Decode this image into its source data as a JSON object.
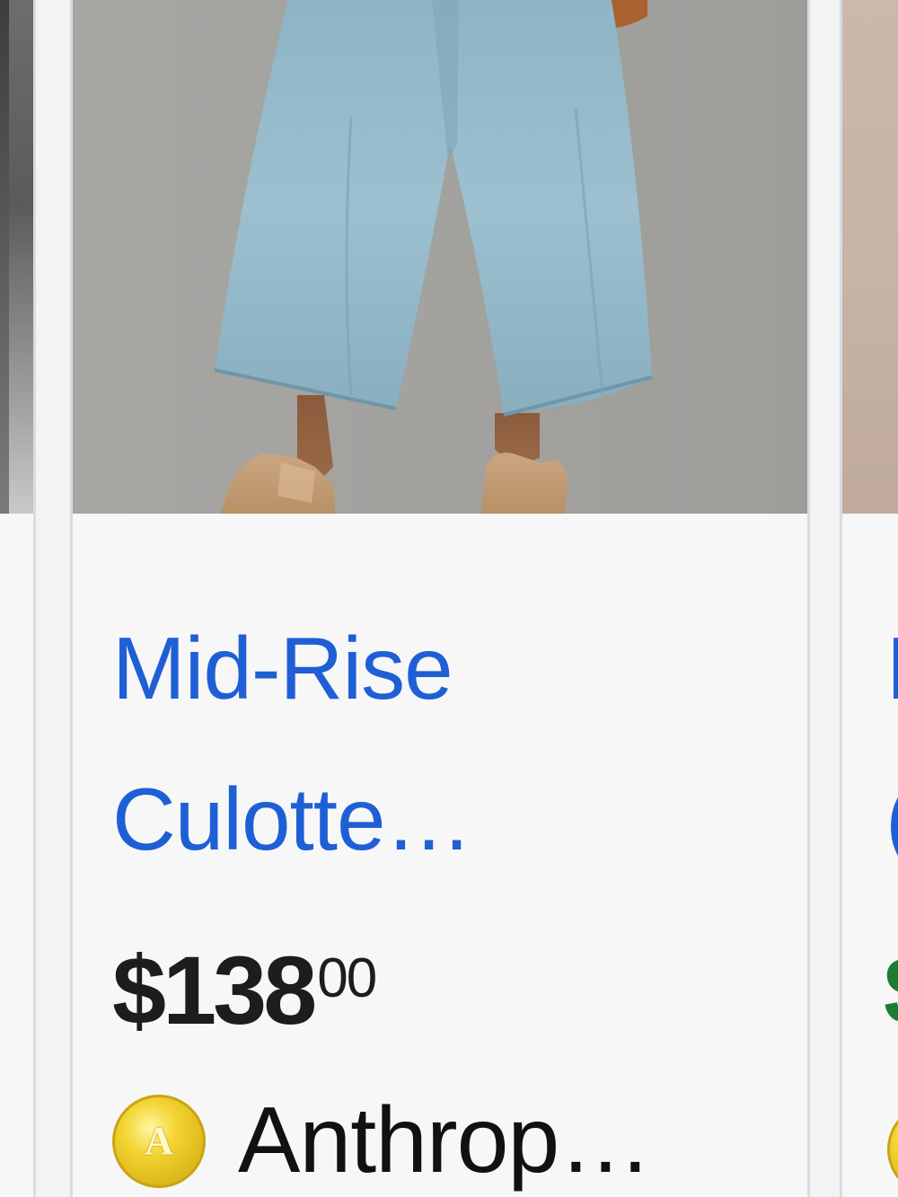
{
  "product": {
    "title_line1": "Mid-Rise",
    "title_line2": "Culotte…",
    "price_dollars": "$138",
    "price_cents": "00",
    "seller_name": "Anthrop…",
    "seller_logo_letter": "A"
  },
  "colors": {
    "title_link": "#1f5fd6",
    "price": "#1d1d1d",
    "next_price": "#1e7b34",
    "card_background": "#f7f7f7",
    "card_border": "#d9dbde",
    "seller_logo": "#f2d431"
  },
  "next_card": {
    "title_peek_line1": "I",
    "title_peek_line2": "(",
    "price_peek": "$"
  },
  "icons": {
    "seller_logo": "gold-coin-logo-icon"
  }
}
